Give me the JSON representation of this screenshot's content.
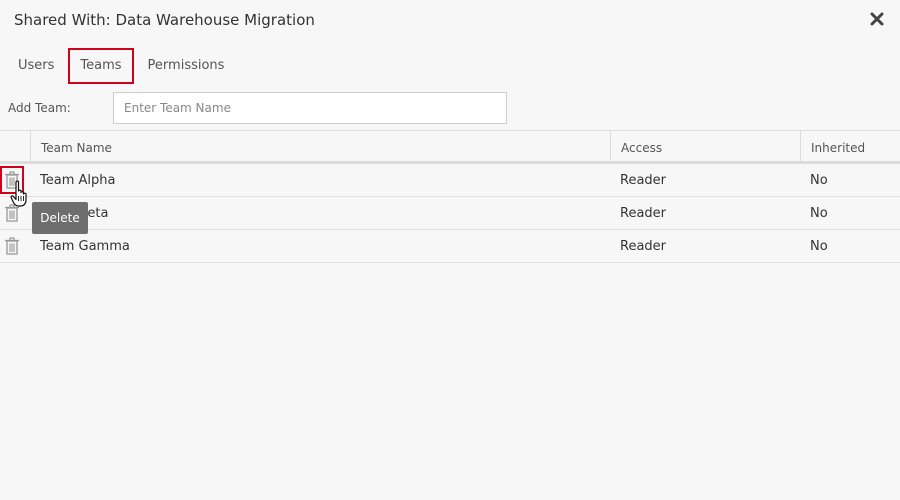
{
  "dialog": {
    "title": "Shared With: Data Warehouse Migration"
  },
  "tabs": [
    {
      "label": "Users",
      "active": false
    },
    {
      "label": "Teams",
      "active": true
    },
    {
      "label": "Permissions",
      "active": false
    }
  ],
  "add_team": {
    "label": "Add Team:",
    "placeholder": "Enter Team Name",
    "value": ""
  },
  "table": {
    "columns": [
      "Team Name",
      "Access",
      "Inherited"
    ],
    "rows": [
      {
        "name": "Team Alpha",
        "access": "Reader",
        "inherited": "No"
      },
      {
        "name": "Team Beta",
        "access": "Reader",
        "inherited": "No"
      },
      {
        "name": "Team Gamma",
        "access": "Reader",
        "inherited": "No"
      }
    ]
  },
  "tooltip": {
    "text": "Delete"
  },
  "colors": {
    "highlight": "#d0021b",
    "tooltip_bg": "#6e6e6e",
    "background": "#f7f7f7"
  },
  "icons": {
    "close": "close-icon",
    "delete": "trash-icon",
    "cursor": "hand-pointer-icon"
  }
}
